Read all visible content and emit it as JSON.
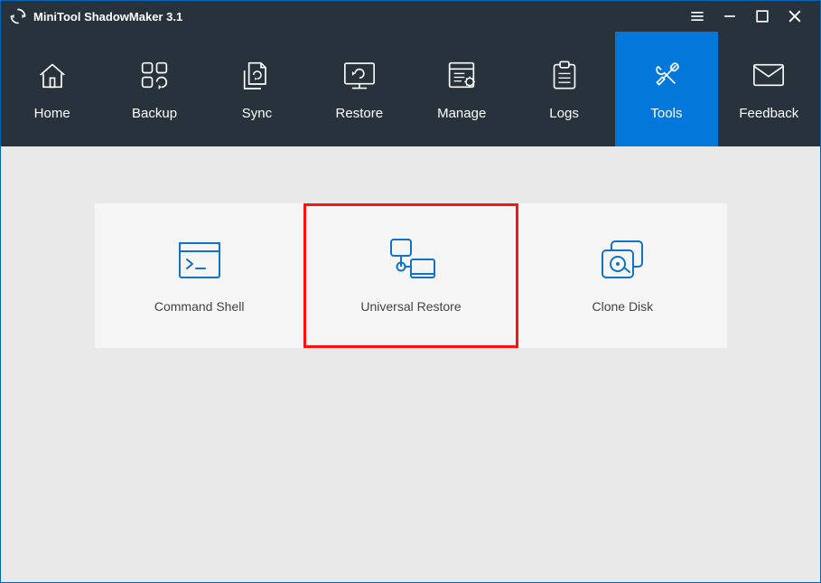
{
  "app": {
    "title": "MiniTool ShadowMaker 3.1"
  },
  "nav": {
    "items": [
      {
        "label": "Home"
      },
      {
        "label": "Backup"
      },
      {
        "label": "Sync"
      },
      {
        "label": "Restore"
      },
      {
        "label": "Manage"
      },
      {
        "label": "Logs"
      },
      {
        "label": "Tools"
      },
      {
        "label": "Feedback"
      }
    ],
    "active_index": 6
  },
  "tools": {
    "cards": [
      {
        "label": "Command Shell"
      },
      {
        "label": "Universal Restore"
      },
      {
        "label": "Clone Disk"
      }
    ],
    "highlighted_index": 1
  },
  "colors": {
    "titlebar_bg": "#28323c",
    "accent": "#0477da",
    "window_border": "#0565b4",
    "content_bg": "#e9e9e9",
    "panel_bg": "#f5f5f5",
    "highlight_border": "#fc120f",
    "tool_icon_stroke": "#1173c7"
  }
}
